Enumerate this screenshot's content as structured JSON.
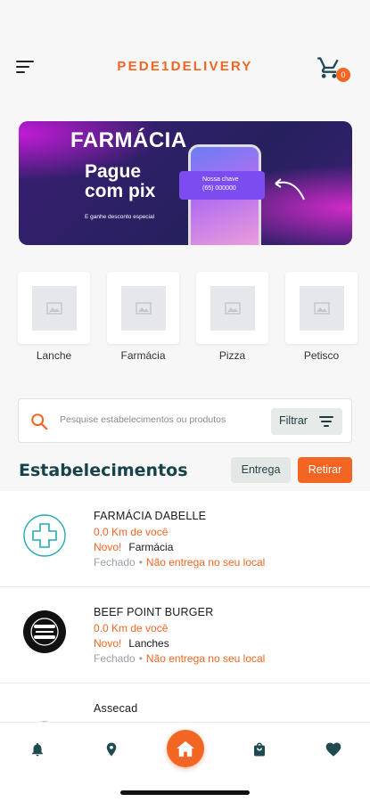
{
  "header": {
    "brand": "PEDE1DELIVERY",
    "cart_count": "0",
    "icons": {
      "menu": "sort-menu-icon",
      "cart": "shopping-cart-icon"
    }
  },
  "banner": {
    "title": "FARMÁCIA",
    "headline": "Pague com pix",
    "subtitle": "E ganhe desconto especial",
    "pix_label": "Nossa chave",
    "pix_key": "(65) 000000"
  },
  "categories": [
    {
      "label": "Lanche"
    },
    {
      "label": "Farmácia"
    },
    {
      "label": "Pizza"
    },
    {
      "label": "Petisco"
    }
  ],
  "search": {
    "placeholder": "Pesquise estabelecimentos ou produtos",
    "filter_label": "Filtrar"
  },
  "section": {
    "title": "Estabelecimentos",
    "tab_delivery": "Entrega",
    "tab_pickup": "Retirar"
  },
  "stores": [
    {
      "name": "FARMÁCIA DABELLE",
      "distance": "0.0 Km de você",
      "badge": "Novo!",
      "category": "Farmácia",
      "status": "Fechado",
      "delivery": "Não entrega no seu local"
    },
    {
      "name": "BEEF POINT BURGER",
      "distance": "0.0 Km de você",
      "badge": "Novo!",
      "category": "Lanches",
      "status": "Fechado",
      "delivery": "Não entrega no seu local"
    },
    {
      "name": "Assecad",
      "distance": "",
      "badge": "",
      "category": "",
      "status": "",
      "delivery": ""
    }
  ],
  "status_separator": "•",
  "bottom_nav": {
    "icons": [
      "bell-icon",
      "location-pin-icon",
      "home-icon",
      "shopping-bag-icon",
      "heart-icon"
    ]
  },
  "colors": {
    "accent": "#f26522",
    "primary_dark": "#17444a",
    "nav_icon": "#1f4a4f"
  }
}
